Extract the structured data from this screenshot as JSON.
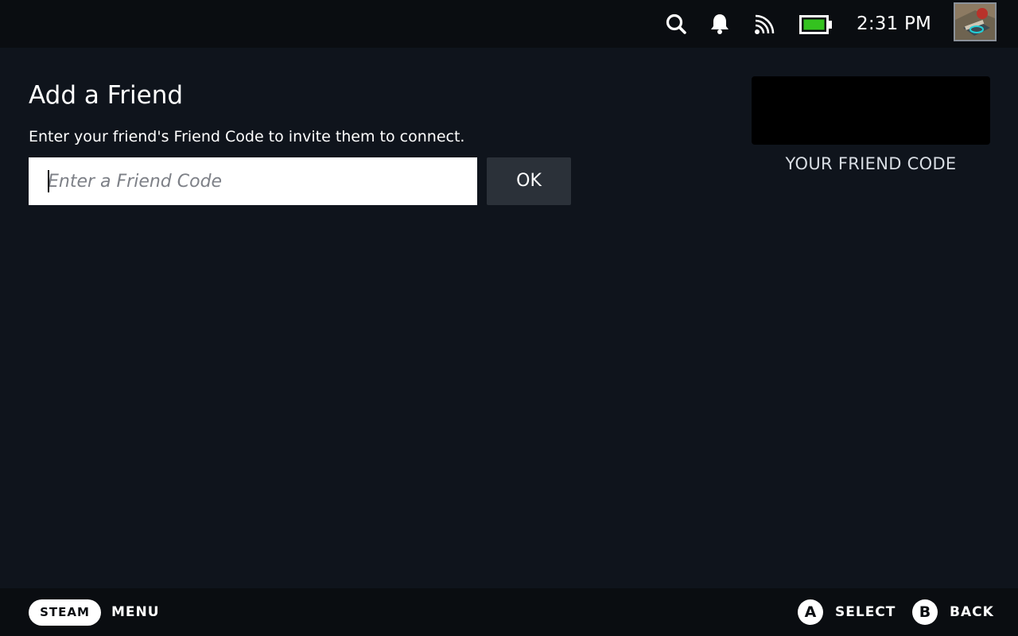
{
  "status_bar": {
    "icons": [
      "search-icon",
      "bell-icon",
      "signal-icon",
      "battery-icon"
    ],
    "time": "2:31 PM",
    "battery_color": "#34c21f"
  },
  "page": {
    "title": "Add a Friend",
    "description": "Enter your friend's Friend Code to invite them to connect.",
    "input": {
      "value": "",
      "placeholder": "Enter a Friend Code"
    },
    "ok_label": "OK",
    "your_code_label": "YOUR FRIEND CODE"
  },
  "footer": {
    "steam_label": "STEAM",
    "menu_label": "MENU",
    "a_glyph": "A",
    "select_label": "SELECT",
    "b_glyph": "B",
    "back_label": "BACK"
  },
  "colors": {
    "background": "#0f141c",
    "bar_background": "#0a0d11",
    "button_background": "#2b3139"
  }
}
